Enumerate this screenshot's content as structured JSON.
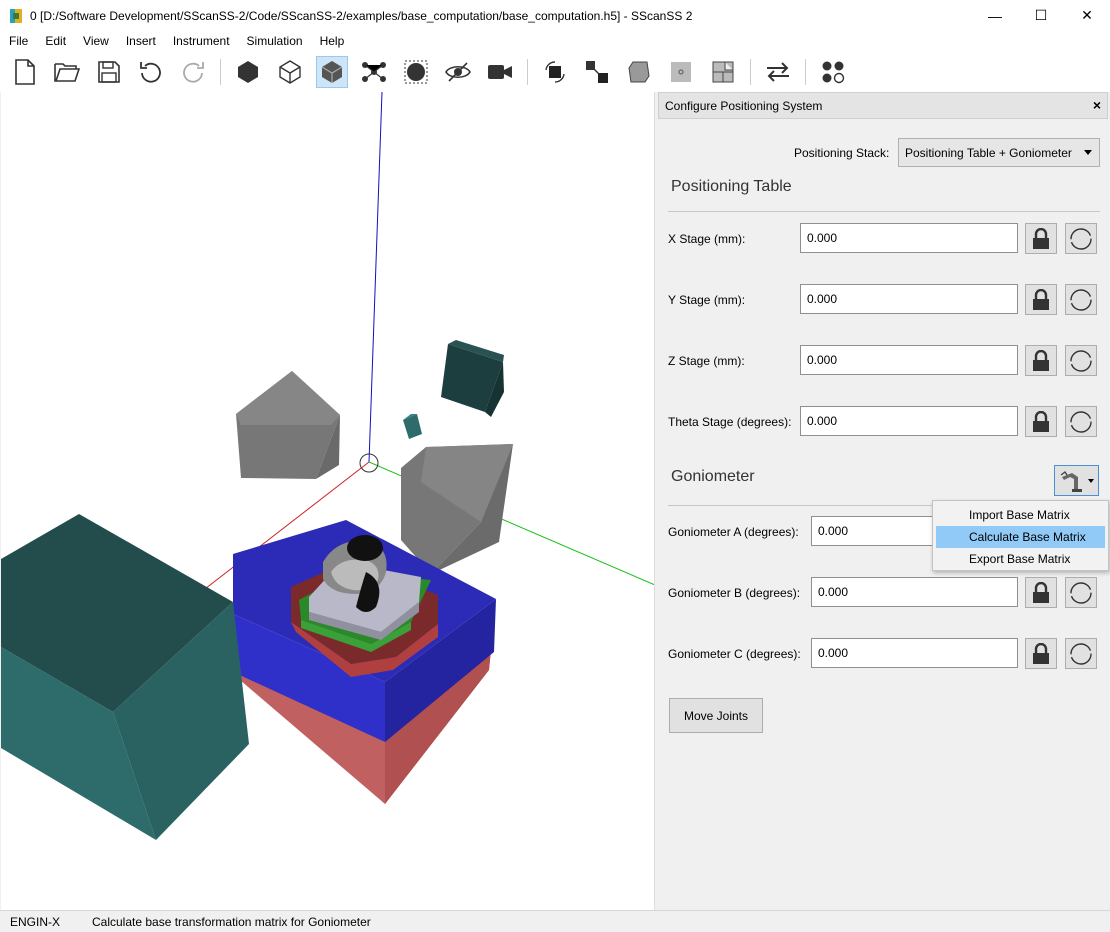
{
  "window": {
    "title": "0 [D:/Software Development/SScanSS-2/Code/SScanSS-2/examples/base_computation/base_computation.h5] - SScanSS 2",
    "minimize": "—",
    "maximize": "☐",
    "close": "✕"
  },
  "menu": [
    "File",
    "Edit",
    "View",
    "Insert",
    "Instrument",
    "Simulation",
    "Help"
  ],
  "toolbar": {
    "icons": [
      "new-file-icon",
      "open-folder-icon",
      "save-icon",
      "undo-icon",
      "redo-icon",
      "solid-render-icon",
      "wireframe-render-icon",
      "transparent-render-icon",
      "fiducials-icon",
      "measurement-points-icon",
      "toggle-visibility-icon",
      "camera-icon",
      "rotate-sample-icon",
      "translate-sample-icon",
      "transform-matrix-icon",
      "move-origin-icon",
      "plane-align-icon",
      "swap-icon",
      "collimator-icon"
    ],
    "active_index": 7
  },
  "dock": {
    "title": "Configure Positioning System",
    "close": "×",
    "stack_label": "Positioning Stack:",
    "stack_value": "Positioning Table + Goniometer",
    "groups": [
      {
        "title": "Positioning Table",
        "fields": [
          {
            "label": "X Stage (mm):",
            "value": "0.000"
          },
          {
            "label": "Y Stage (mm):",
            "value": "0.000"
          },
          {
            "label": "Z Stage (mm):",
            "value": "0.000"
          },
          {
            "label": "Theta Stage (degrees):",
            "value": "0.000"
          }
        ]
      },
      {
        "title": "Goniometer",
        "fields": [
          {
            "label": "Goniometer A (degrees):",
            "value": "0.000"
          },
          {
            "label": "Goniometer B (degrees):",
            "value": "0.000"
          },
          {
            "label": "Goniometer C (degrees):",
            "value": "0.000"
          }
        ]
      }
    ],
    "base_matrix_menu": [
      "Import Base Matrix",
      "Calculate Base Matrix",
      "Export Base Matrix"
    ],
    "highlighted_menu_item": "Calculate Base Matrix",
    "move_button": "Move Joints"
  },
  "status": {
    "instrument": "ENGIN-X",
    "message": "Calculate base transformation matrix for Goniometer"
  },
  "colors": {
    "accent": "#99c9ef",
    "highlight": "#91c9f7",
    "teal_block": "#2e6b6b",
    "blue_stage": "#2b2bb8",
    "red_stage": "#c06060"
  }
}
